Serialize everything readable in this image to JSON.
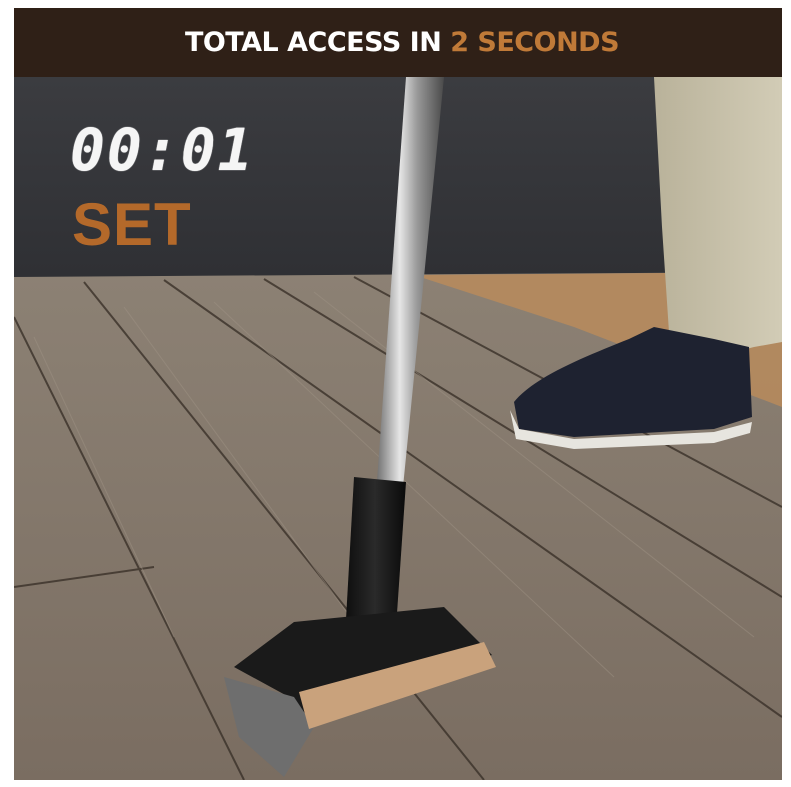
{
  "banner": {
    "prefix": "TOTAL ACCESS IN ",
    "accent": "2 SECONDS"
  },
  "overlay": {
    "timer": "00:01",
    "state": "SET"
  },
  "colors": {
    "banner_bg": "#2f2017",
    "accent": "#c07a38",
    "state_text": "#b4692a",
    "timer_text": "#f5f5f5"
  },
  "photo": {
    "icon": "deck-board-lifter-photo"
  }
}
